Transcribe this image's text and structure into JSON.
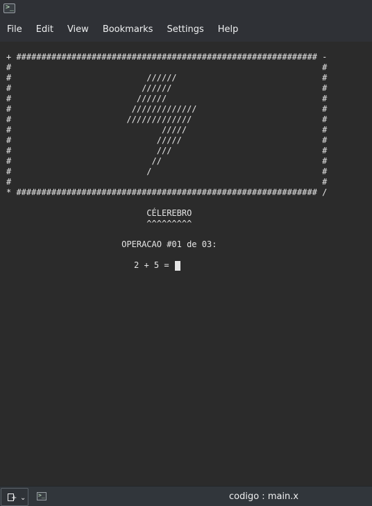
{
  "window": {
    "icon": "terminal-icon"
  },
  "menu": {
    "items": [
      "File",
      "Edit",
      "View",
      "Bookmarks",
      "Settings",
      "Help"
    ]
  },
  "terminal": {
    "banner_lines": [
      "+ ############################################################ -",
      "#                                                              #",
      "#                           //////                             #",
      "#                          //////                              #",
      "#                         //////                               #",
      "#                        /////////////                         #",
      "#                       /////////////                          #",
      "#                              /////                           #",
      "#                             /////                            #",
      "#                             ///                              #",
      "#                            //                                #",
      "#                           /                                  #",
      "#                                                              #",
      "* ############################################################ /",
      "",
      "                            CÉLEREBRO",
      "                            ^^^^^^^^^",
      "",
      "                       OPERACAO #01 de 03:"
    ],
    "question": "2 + 5 = ",
    "cursor_color": "#e6e6e6",
    "background": "#2b2b2b",
    "foreground": "#e6e6e6"
  },
  "tabbar": {
    "new_tab_icon": "new-tab-icon",
    "dropdown_icon": "chevron-down-icon",
    "tab_icon": "terminal-icon",
    "tab_title": "codigo : main.x"
  }
}
